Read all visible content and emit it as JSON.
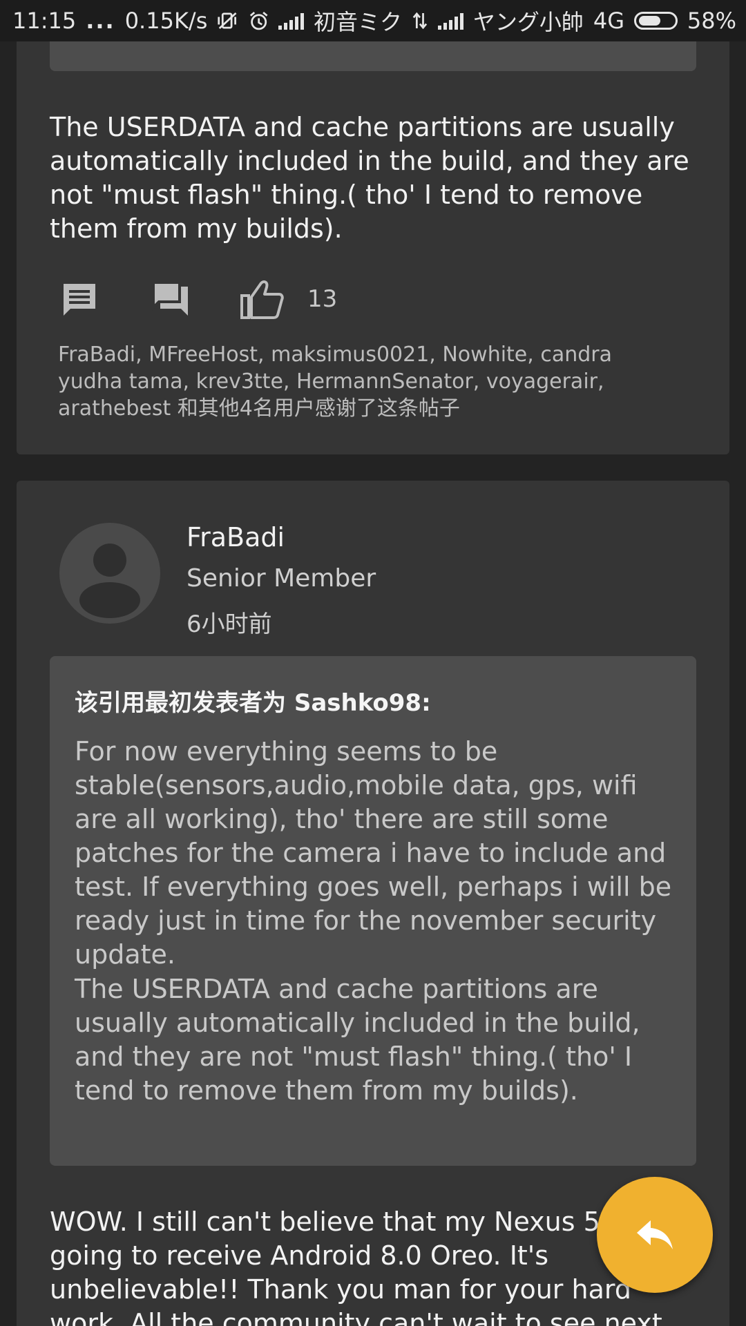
{
  "status_bar": {
    "time": "11:15",
    "dots": "...",
    "net_speed": "0.15K/s",
    "carrier_1": "初音ミク",
    "carrier_2": "ヤング小帥",
    "network_type": "4G",
    "battery_percent": "58%",
    "battery_level": 0.58,
    "icons": [
      "vibrate-mute-icon",
      "alarm-icon",
      "signal-icon",
      "data-arrows-icon",
      "signal-icon",
      "battery-icon"
    ]
  },
  "post_1": {
    "text": "The USERDATA and cache partitions are usually automatically included in the build, and they are not \"must flash\" thing.( tho' I tend to remove them from my builds).",
    "actions": {
      "icons": [
        "comment-icon",
        "quote-reply-icon",
        "thumbs-up-icon"
      ],
      "like_count": "13"
    },
    "thanks": "FraBadi, MFreeHost, maksimus0021, Nowhite, candra yudha tama, krev3tte, HermannSenator, voyagerair, arathebest 和其他4名用户感谢了这条帖子"
  },
  "post_2": {
    "username": "FraBadi",
    "user_title": "Senior Member",
    "time": "6小时前",
    "quote": {
      "heading": "该引用最初发表者为 Sashko98:",
      "paragraph_1": "For now everything seems to be stable(sensors,audio,mobile data, gps, wifi are all working), tho' there are still some patches for the camera i have to include and test. If everything goes well, perhaps i will be ready just in time for the november security update.",
      "paragraph_2": "The USERDATA and cache partitions are usually automatically included in the build, and they are not \"must flash\" thing.( tho' I tend to remove them from my builds)."
    },
    "text": "WOW. I still can't believe that my Nexus 5 is going to receive Android 8.0 Oreo. It's unbelievable!! Thank you man for your hard work. All the community can't wait to see next FakeNexus build"
  },
  "fab": {
    "icon": "reply-icon"
  },
  "colors": {
    "background": "#232323",
    "card": "#353535",
    "quote": "#4d4d4d",
    "accent": "#f0b12f"
  }
}
